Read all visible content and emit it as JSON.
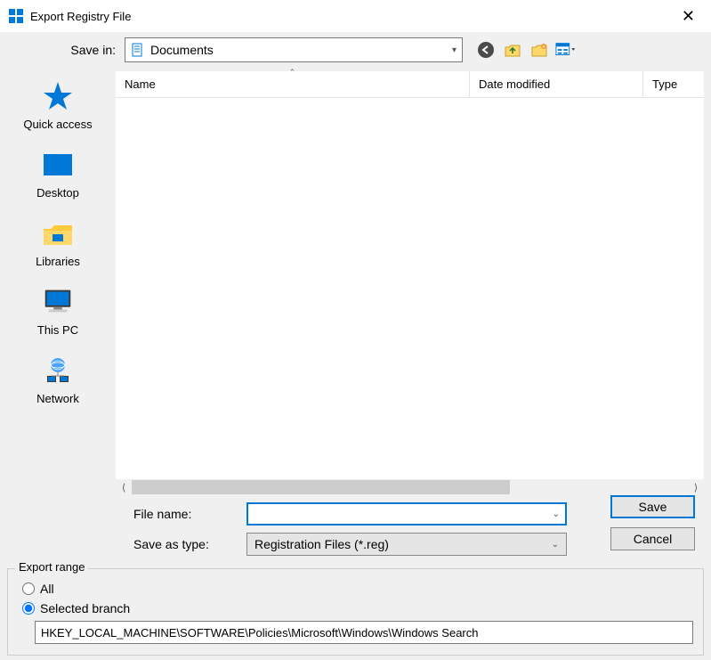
{
  "title": "Export Registry File",
  "save_in": {
    "label": "Save in:",
    "value": "Documents"
  },
  "columns": {
    "name": "Name",
    "date": "Date modified",
    "type": "Type"
  },
  "places": {
    "quick_access": "Quick access",
    "desktop": "Desktop",
    "libraries": "Libraries",
    "this_pc": "This PC",
    "network": "Network"
  },
  "file_name": {
    "label": "File name:",
    "value": ""
  },
  "save_as_type": {
    "label": "Save as type:",
    "value": "Registration Files (*.reg)"
  },
  "buttons": {
    "save": "Save",
    "cancel": "Cancel"
  },
  "export_range": {
    "legend": "Export range",
    "all": "All",
    "selected_branch": "Selected branch",
    "selected": "selected_branch",
    "branch_path": "HKEY_LOCAL_MACHINE\\SOFTWARE\\Policies\\Microsoft\\Windows\\Windows Search"
  },
  "nav_icons": {
    "back": "back-icon",
    "up": "up-one-level-icon",
    "newfolder": "new-folder-icon",
    "viewmenu": "view-menu-icon"
  }
}
